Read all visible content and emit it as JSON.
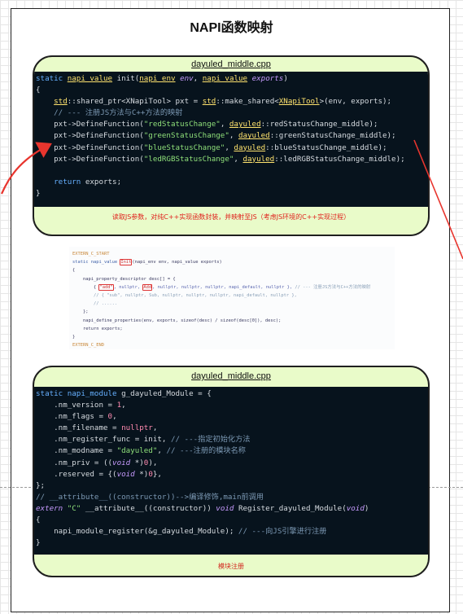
{
  "page_title": "NAPI函数映射",
  "card1": {
    "title": "dayuled_middle.cpp",
    "caption": "读取JS参数，对纯C++实现函数封装，并映射至JS（考虑JS环境的C++实现过程）",
    "code_lines": [
      [
        {
          "t": "static ",
          "c": "#66b0ff"
        },
        {
          "t": "napi_value",
          "c": "#ffe36e",
          "u": true
        },
        {
          "t": " init(",
          "c": "#d6dbe0"
        },
        {
          "t": "napi_env",
          "c": "#ffe36e",
          "u": true
        },
        {
          "t": " env",
          "c": "#c79bff",
          "i": true
        },
        {
          "t": ", ",
          "c": "#d6dbe0"
        },
        {
          "t": "napi_value",
          "c": "#ffe36e",
          "u": true
        },
        {
          "t": " exports",
          "c": "#c79bff",
          "i": true
        },
        {
          "t": ")",
          "c": "#d6dbe0"
        }
      ],
      [
        {
          "t": "{",
          "c": "#d6dbe0"
        }
      ],
      [
        {
          "t": "    ",
          "c": "#d6dbe0"
        },
        {
          "t": "std",
          "c": "#ffe36e",
          "u": true
        },
        {
          "t": "::shared_ptr<XNapiTool> pxt = ",
          "c": "#d6dbe0"
        },
        {
          "t": "std",
          "c": "#ffe36e",
          "u": true
        },
        {
          "t": "::make_shared<",
          "c": "#d6dbe0"
        },
        {
          "t": "XNapiTool",
          "c": "#ffe36e",
          "u": true
        },
        {
          "t": ">(env, exports);",
          "c": "#d6dbe0"
        }
      ],
      [
        {
          "t": "    // --- 注册JS方法与C++方法的映射",
          "c": "#7c99b4"
        }
      ],
      [
        {
          "t": "    pxt->DefineFunction(",
          "c": "#d6dbe0"
        },
        {
          "t": "\"redStatusChange\"",
          "c": "#8fe07a"
        },
        {
          "t": ", ",
          "c": "#d6dbe0"
        },
        {
          "t": "dayuled",
          "c": "#ffe36e",
          "u": true
        },
        {
          "t": "::redStatusChange_middle);",
          "c": "#d6dbe0"
        }
      ],
      [
        {
          "t": "    pxt->DefineFunction(",
          "c": "#d6dbe0"
        },
        {
          "t": "\"greenStatusChange\"",
          "c": "#8fe07a"
        },
        {
          "t": ", ",
          "c": "#d6dbe0"
        },
        {
          "t": "dayuled",
          "c": "#ffe36e",
          "u": true
        },
        {
          "t": "::greenStatusChange_middle);",
          "c": "#d6dbe0"
        }
      ],
      [
        {
          "t": "    pxt->DefineFunction(",
          "c": "#d6dbe0"
        },
        {
          "t": "\"blueStatusChange\"",
          "c": "#8fe07a"
        },
        {
          "t": ", ",
          "c": "#d6dbe0"
        },
        {
          "t": "dayuled",
          "c": "#ffe36e",
          "u": true
        },
        {
          "t": "::blueStatusChange_middle);",
          "c": "#d6dbe0"
        }
      ],
      [
        {
          "t": "    pxt->DefineFunction(",
          "c": "#d6dbe0"
        },
        {
          "t": "\"ledRGBStatusChange\"",
          "c": "#8fe07a"
        },
        {
          "t": ", ",
          "c": "#d6dbe0"
        },
        {
          "t": "dayuled",
          "c": "#ffe36e",
          "u": true
        },
        {
          "t": "::ledRGBStatusChange_middle);",
          "c": "#d6dbe0"
        }
      ],
      [
        {
          "t": "",
          "c": "#d6dbe0"
        }
      ],
      [
        {
          "t": "    return ",
          "c": "#66b0ff"
        },
        {
          "t": "exports;",
          "c": "#d6dbe0"
        }
      ],
      [
        {
          "t": "}",
          "c": "#d6dbe0"
        }
      ]
    ]
  },
  "snippet": {
    "lines": [
      [
        {
          "t": "EXTERN_C_START",
          "c": "#c8883a"
        }
      ],
      [
        {
          "t": "static napi_value ",
          "c": "#3d5fa8"
        },
        {
          "t": "Init",
          "c": "#c33",
          "box": true
        },
        {
          "t": "(napi_env env, napi_value exports)",
          "c": "#3a3a60"
        }
      ],
      [
        {
          "t": "{",
          "c": "#3a3a60"
        }
      ],
      [
        {
          "t": "    napi_property_descriptor desc[] = {",
          "c": "#3a3a60"
        }
      ],
      [
        {
          "t": "        { ",
          "c": "#3a3a60"
        },
        {
          "t": "\"add\"",
          "c": "#c33",
          "box": true
        },
        {
          "t": ", nullptr, ",
          "c": "#5b67b0"
        },
        {
          "t": "Add",
          "c": "#c33",
          "box": true
        },
        {
          "t": ", nullptr, nullptr, nullptr, napi_default, nullptr }, ",
          "c": "#5b67b0"
        },
        {
          "t": "// --- 注册JS方法与C++方法的映射",
          "c": "#8aa0b8"
        }
      ],
      [
        {
          "t": "        // { \"sub\", nullptr, Sub, nullptr, nullptr, nullptr, napi_default, nullptr },",
          "c": "#8aa0b8"
        }
      ],
      [
        {
          "t": "        // ......",
          "c": "#8aa0b8"
        }
      ],
      [
        {
          "t": "    };",
          "c": "#3a3a60"
        }
      ],
      [
        {
          "t": "    napi_define_properties(env, exports, sizeof(desc) / sizeof(desc[0]), desc);",
          "c": "#3a3a60"
        }
      ],
      [
        {
          "t": "    return exports;",
          "c": "#3a3a60"
        }
      ],
      [
        {
          "t": "}",
          "c": "#3a3a60"
        }
      ],
      [
        {
          "t": "EXTERN_C_END",
          "c": "#c8883a"
        }
      ]
    ]
  },
  "card2": {
    "title": "dayuled_middle.cpp",
    "caption": "模块注册",
    "code_lines": [
      [
        {
          "t": "static napi_module ",
          "c": "#66b0ff"
        },
        {
          "t": "g_dayuled_Module = {",
          "c": "#d6dbe0"
        }
      ],
      [
        {
          "t": "    .nm_version = ",
          "c": "#d6dbe0"
        },
        {
          "t": "1",
          "c": "#ff8ab0"
        },
        {
          "t": ",",
          "c": "#d6dbe0"
        }
      ],
      [
        {
          "t": "    .nm_flags = ",
          "c": "#d6dbe0"
        },
        {
          "t": "0",
          "c": "#ff8ab0"
        },
        {
          "t": ",",
          "c": "#d6dbe0"
        }
      ],
      [
        {
          "t": "    .nm_filename = ",
          "c": "#d6dbe0"
        },
        {
          "t": "nullptr",
          "c": "#ff8ab0"
        },
        {
          "t": ",",
          "c": "#d6dbe0"
        }
      ],
      [
        {
          "t": "    .nm_register_func = init, ",
          "c": "#d6dbe0"
        },
        {
          "t": "// ---指定初始化方法",
          "c": "#7c99b4"
        }
      ],
      [
        {
          "t": "    .nm_modname = ",
          "c": "#d6dbe0"
        },
        {
          "t": "\"dayuled\"",
          "c": "#8fe07a"
        },
        {
          "t": ", ",
          "c": "#d6dbe0"
        },
        {
          "t": "// ---注册的模块名称",
          "c": "#7c99b4"
        }
      ],
      [
        {
          "t": "    .nm_priv = ((",
          "c": "#d6dbe0"
        },
        {
          "t": "void",
          "c": "#c79bff",
          "i": true
        },
        {
          "t": " *)",
          "c": "#d6dbe0"
        },
        {
          "t": "0",
          "c": "#ff8ab0"
        },
        {
          "t": "),",
          "c": "#d6dbe0"
        }
      ],
      [
        {
          "t": "    .reserved = {(",
          "c": "#d6dbe0"
        },
        {
          "t": "void",
          "c": "#c79bff",
          "i": true
        },
        {
          "t": " *)",
          "c": "#d6dbe0"
        },
        {
          "t": "0",
          "c": "#ff8ab0"
        },
        {
          "t": "},",
          "c": "#d6dbe0"
        }
      ],
      [
        {
          "t": "};",
          "c": "#d6dbe0"
        }
      ],
      [
        {
          "t": "// __attribute__((constructor))-->编译修饰,main前调用",
          "c": "#7c99b4"
        }
      ],
      [
        {
          "t": "extern ",
          "c": "#c79bff",
          "i": true
        },
        {
          "t": "\"C\" ",
          "c": "#8fe07a"
        },
        {
          "t": "__attribute__((constructor)) ",
          "c": "#d6dbe0"
        },
        {
          "t": "void ",
          "c": "#c79bff",
          "i": true
        },
        {
          "t": "Register_dayuled_Module(",
          "c": "#d6dbe0"
        },
        {
          "t": "void",
          "c": "#c79bff",
          "i": true
        },
        {
          "t": ")",
          "c": "#d6dbe0"
        }
      ],
      [
        {
          "t": "{",
          "c": "#d6dbe0"
        }
      ],
      [
        {
          "t": "    napi_module_register(&g_dayuled_Module); ",
          "c": "#d6dbe0"
        },
        {
          "t": "// ---向JS引擎进行注册",
          "c": "#7c99b4"
        }
      ],
      [
        {
          "t": "}",
          "c": "#d6dbe0"
        }
      ]
    ]
  },
  "colors": {
    "card_bg": "#e9fbc9",
    "code_bg": "#07131d",
    "caption_red": "#e0201c",
    "arrow_red": "#e8352e"
  }
}
